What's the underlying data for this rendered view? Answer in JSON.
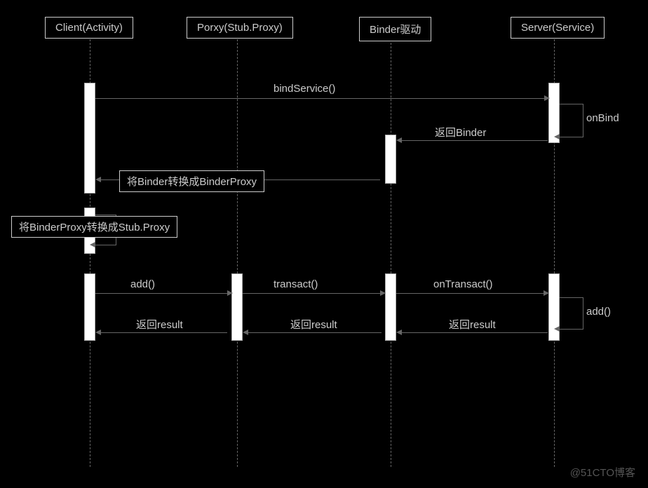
{
  "participants": {
    "client": "Client(Activity)",
    "proxy": "Porxy(Stub.Proxy)",
    "binder": "Binder驱动",
    "server": "Server(Service)"
  },
  "messages": {
    "bindService": "bindService()",
    "onBind": "onBind",
    "returnBinder": "返回Binder",
    "binderToProxy": "将Binder转换成BinderProxy",
    "binderProxyToStub": "将BinderProxy转换成Stub.Proxy",
    "add": "add()",
    "transact": "transact()",
    "onTransact": "onTransact()",
    "addServer": "add()",
    "returnResult1": "返回result",
    "returnResult2": "返回result",
    "returnResult3": "返回result"
  },
  "watermark": "@51CTO博客"
}
